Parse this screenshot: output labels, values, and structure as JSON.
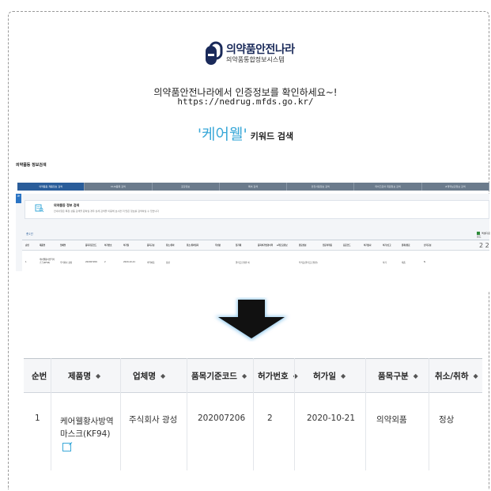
{
  "logo": {
    "main": "의약품안전나라",
    "sub": "의약품통합정보시스템",
    "brand_color": "#1a2a5a"
  },
  "intro": {
    "line1": "의약품안전나라에서 인증정보를 확인하세요~!",
    "line2": "https://nedrug.mfds.go.kr/"
  },
  "keyword": {
    "term": "'케어웰'",
    "suffix": "키워드 검색",
    "accent_color": "#3aa8d8"
  },
  "mini": {
    "title": "의약품등 정보검색",
    "tabs": [
      "의약품등 제품정보 검색",
      "DUR품목 검색",
      "포장정보",
      "특허 검색",
      "안전사용정보 검색",
      "마이크로어 회원정보 검색",
      "#계약보관정보 검색"
    ],
    "side_label": "≫",
    "box_title": "의약품등 정보 검색",
    "box_desc": "안내사항은 특정 상품 검색을 원하실 경우 상세 검색을 이용해 보시면 더 많은 정보를 검색하실 수 있습니다",
    "count": "총1건",
    "excel": "엑셀다운로드",
    "headers": [
      "순번",
      "제품명",
      "업체명",
      "품목기준코드",
      "허가번호",
      "허가일",
      "품목구분",
      "취소/취하",
      "취소/취하일자",
      "주성분",
      "첨가제",
      "품목허가변경이력",
      "e약은요정보",
      "원료성분",
      "전문의약품",
      "표준코드",
      "허가심사",
      "허가/신고",
      "완제/원료",
      "신약구분"
    ],
    "row": [
      "1",
      "케어웰황사방역마스크(KF94)",
      "주식회사 광성",
      "202007206",
      "2",
      "2020-10-21",
      "의약외품",
      "정상",
      "",
      "",
      "폴리프로필렌 외",
      "",
      "",
      "부직포(폴리프로필렌)",
      "",
      "",
      "",
      "허가",
      "제품",
      "N"
    ],
    "end_marker": "2 2"
  },
  "zoom": {
    "headers": [
      "순번",
      "제품명",
      "업체명",
      "품목기준코드",
      "허가번호",
      "허가일",
      "품목구분",
      "취소/취하"
    ],
    "sort_icon": "◆",
    "row": {
      "index": "1",
      "product_name": "케어웰황사방역마스크(KF94)",
      "company": "주식회사 광성",
      "item_code": "202007206",
      "permit_no": "2",
      "permit_date": "2020-10-21",
      "category": "의약외품",
      "status": "정상"
    }
  }
}
